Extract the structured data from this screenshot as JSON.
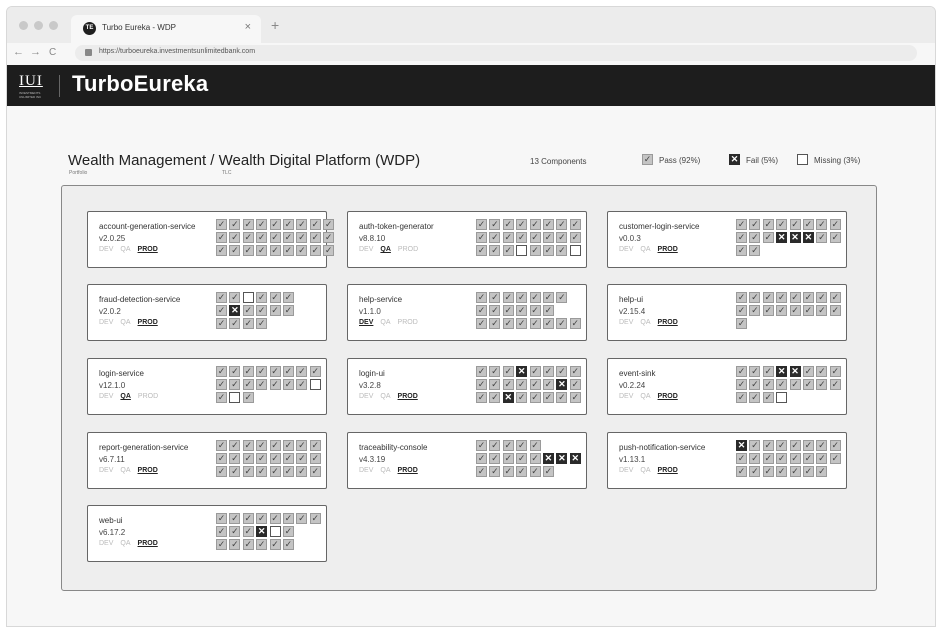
{
  "browser": {
    "tab_title": "Turbo Eureka - WDP",
    "tab_close": "×",
    "new_tab": "+",
    "url": "https://turboeureka.investmentsunlimitedbank.com",
    "back": "←",
    "forward": "→",
    "reload": "C"
  },
  "app": {
    "logo_text": "IUI",
    "logo_subtext": "INVESTMENTS UNLIMITED INC",
    "name": "TurboEureka"
  },
  "page": {
    "title": "Wealth Management / Wealth Digital Platform (WDP)",
    "portfolio_label": "Portfolio",
    "tlc_label": "TLC",
    "component_count": "13 Components",
    "legend": {
      "pass": "Pass (92%)",
      "fail": "Fail (5%)",
      "missing": "Missing (3%)"
    }
  },
  "env_labels": [
    "DEV",
    "QA",
    "PROD"
  ],
  "components": [
    {
      "name": "account-generation-service",
      "version": "v2.0.25",
      "active_env": "PROD",
      "rows": [
        "ppppppppp",
        "ppppppppp",
        "ppppppppp"
      ]
    },
    {
      "name": "auth-token-generator",
      "version": "v8.8.10",
      "active_env": "QA",
      "rows": [
        "pppppppp",
        "pppppppp",
        "pppmpppm"
      ]
    },
    {
      "name": "customer-login-service",
      "version": "v0.0.3",
      "active_env": "PROD",
      "rows": [
        "pppppppp",
        "pppfffpp",
        "pp"
      ]
    },
    {
      "name": "fraud-detection-service",
      "version": "v2.0.2",
      "active_env": "PROD",
      "rows": [
        "ppmppp",
        "pfpppp",
        "pppp"
      ]
    },
    {
      "name": "help-service",
      "version": "v1.1.0",
      "active_env": "DEV",
      "rows": [
        "ppppppp",
        "pppppp",
        "pppppppp"
      ]
    },
    {
      "name": "help-ui",
      "version": "v2.15.4",
      "active_env": "PROD",
      "rows": [
        "pppppppp",
        "pppppppp",
        "p"
      ]
    },
    {
      "name": "login-service",
      "version": "v12.1.0",
      "active_env": "QA",
      "rows": [
        "pppppppp",
        "pppppppm",
        "pmp"
      ]
    },
    {
      "name": "login-ui",
      "version": "v3.2.8",
      "active_env": "PROD",
      "rows": [
        "pppfpppp",
        "ppppppfp",
        "ppfppppp"
      ]
    },
    {
      "name": "event-sink",
      "version": "v0.2.24",
      "active_env": "PROD",
      "rows": [
        "pppffppp",
        "pppppppp",
        "pppm"
      ]
    },
    {
      "name": "report-generation-service",
      "version": "v6.7.11",
      "active_env": "PROD",
      "rows": [
        "pppppppp",
        "pppppppp",
        "pppppppp"
      ]
    },
    {
      "name": "traceability-console",
      "version": "v4.3.19",
      "active_env": "PROD",
      "rows": [
        "ppppp",
        "pppppfff",
        "pppppp"
      ]
    },
    {
      "name": "push-notification-service",
      "version": "v1.13.1",
      "active_env": "PROD",
      "rows": [
        "fppppppp",
        "pppppppp",
        "ppppppp"
      ]
    },
    {
      "name": "web-ui",
      "version": "v6.17.2",
      "active_env": "PROD",
      "rows": [
        "pppppppp",
        "pppfmp",
        "pppppp"
      ]
    }
  ],
  "glyphs": {
    "pass": "✓",
    "fail": "✕",
    "missing": ""
  },
  "colors": {
    "appbar": "#1d1d1d",
    "pass": "#c4c4c4",
    "fail": "#2a2a2a",
    "missing": "#ffffff"
  },
  "icons": {
    "tab_logo": "turboeureka-logo-icon",
    "lock": "lock-icon"
  }
}
